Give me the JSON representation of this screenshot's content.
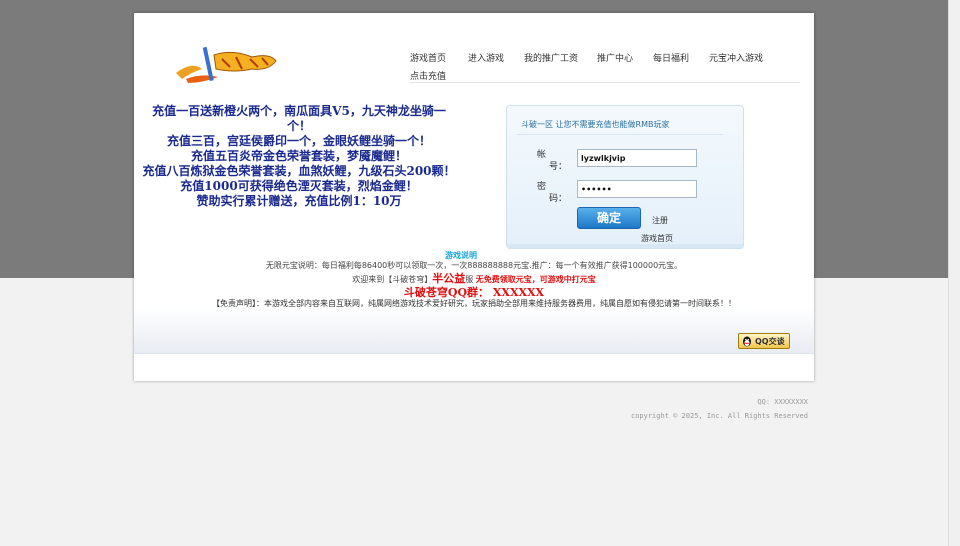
{
  "nav": {
    "items": [
      {
        "label": "游戏首页"
      },
      {
        "label": "进入游戏"
      },
      {
        "label": "我的推广工资"
      },
      {
        "label": "推广中心"
      },
      {
        "label": "每日福利"
      },
      {
        "label": "元宝冲入游戏"
      },
      {
        "label": "点击充值"
      }
    ]
  },
  "promo": {
    "lines": [
      "充值一百送新橙火两个，南瓜面具V5，九天神龙坐骑一个！",
      "充值三百，宫廷侯爵印一个，金眼妖鲤坐骑一个！",
      "充值五百炎帝金色荣誉套装，梦魇魔鲤！",
      "充值八百炼狱金色荣誉套装，血煞妖鲤，九级石头200颗！",
      "充值1000可获得绝色湮灭套装，烈焰金鲤！",
      "赞助实行累计赠送，充值比例1：10万"
    ]
  },
  "login": {
    "title": "斗破一区 让您不需要充值也能做RMB玩家",
    "account_label_1": "帐",
    "account_label_2": "号：",
    "account_value": "lyzwlkjvip",
    "password_label_1": "密",
    "password_label_2": "码：",
    "password_value": "••••••",
    "submit_label": "确定",
    "register_label": "注册",
    "home_label": "游戏首页"
  },
  "info": {
    "game_desc_link": "游戏说明",
    "yuanbao_line": "无限元宝说明：每日福利每86400秒可以领取一次，一次888888888元宝.推广：每一个有效推广获得100000元宝。",
    "welcome_prefix": "欢迎来到【斗破苍穹】",
    "welcome_big": "半公益",
    "welcome_mid": "服",
    "welcome_red": "无免费领取元宝，可游戏中打元宝",
    "qq_group": "斗破苍穹QQ群：  XXXXXX",
    "disclaimer": "【免责声明】：本游戏全部内容来自互联网，纯属网络游戏技术爱好研究，玩家捐助全部用来维持服务器费用，纯属自愿如有侵犯请第一时间联系！！",
    "qq_button": "QQ交谈"
  },
  "footer": {
    "qq": "QQ: XXXXXXXX",
    "copyright": "copyright © 2025, Inc. All Rights Reserved"
  },
  "colors": {
    "promo_blue": "#1a2a8f",
    "link_cyan": "#1aa7d8",
    "alert_red": "#e01010",
    "button_blue": "#1d78c8"
  }
}
